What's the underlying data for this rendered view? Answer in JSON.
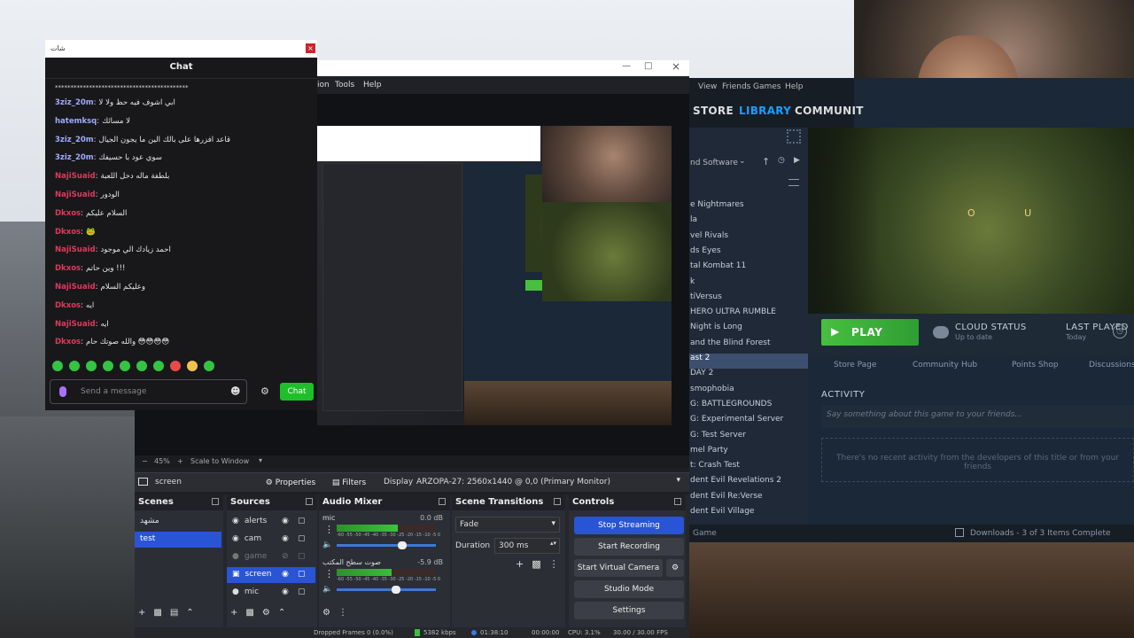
{
  "chat": {
    "window_title": "شات",
    "header": "Chat",
    "separator_line": "*******************************************",
    "messages": [
      {
        "user": "3ziz_20m",
        "user_color": "#9fa9ff",
        "text": "ابي اشوف فيه حظ ولا لا"
      },
      {
        "user": "hatemksq",
        "user_color": "#9fa9ff",
        "text": "لا مسائك"
      },
      {
        "user": "3ziz_20m",
        "user_color": "#9fa9ff",
        "text": "قاعد افزرها على بالك الين ما يجون الجيال"
      },
      {
        "user": "3ziz_20m",
        "user_color": "#9fa9ff",
        "text": "سوي عود با حسيفك"
      },
      {
        "user": "NajiSuaid",
        "user_color": "#e0395c",
        "text": "بلطفة ماله دخل اللعبة"
      },
      {
        "user": "NajiSuaid",
        "user_color": "#e0395c",
        "text": "الودور"
      },
      {
        "user": "Dkxos",
        "user_color": "#e0395c",
        "text": "السلام عليكم"
      },
      {
        "user": "Dkxos",
        "user_color": "#e0395c",
        "text": "🐸"
      },
      {
        "user": "NajiSuaid",
        "user_color": "#e0395c",
        "text": "احمد زيادك الي موجود"
      },
      {
        "user": "Dkxos",
        "user_color": "#e0395c",
        "text": "وين حاتم !!!"
      },
      {
        "user": "NajiSuaid",
        "user_color": "#e0395c",
        "text": "وعليكم السلام"
      },
      {
        "user": "Dkxos",
        "user_color": "#e0395c",
        "text": "ايه"
      },
      {
        "user": "NajiSuaid",
        "user_color": "#e0395c",
        "text": "ايه"
      },
      {
        "user": "Dkxos",
        "user_color": "#e0395c",
        "text": "والله صوتك حام 😳😳😳😳"
      }
    ],
    "input_placeholder": "Send a message",
    "send_label": "Chat"
  },
  "obs": {
    "menu": {
      "tools": "Tools",
      "help": "Help",
      "view_fragment": "ion"
    },
    "status_zoom": "45%",
    "scale_label": "Scale to Window",
    "context": {
      "source_name": "screen",
      "properties": "Properties",
      "filters": "Filters",
      "display_label": "Display",
      "display_value": "ARZOPA-27: 2560x1440 @ 0,0 (Primary Monitor)"
    },
    "scenes": {
      "title": "Scenes",
      "items": [
        "مشهد",
        "test"
      ],
      "selected": 1
    },
    "sources": {
      "title": "Sources",
      "items": [
        "alerts",
        "cam",
        "game",
        "screen",
        "mic"
      ],
      "selected": 3
    },
    "audio": {
      "title": "Audio Mixer",
      "channels": [
        {
          "name": "mic",
          "db": "0.0 dB",
          "level": 0.62
        },
        {
          "name": "صوت سطح المكتب",
          "db": "-5.9 dB",
          "level": 0.55
        }
      ],
      "ticks": "-60 -55 -50 -45 -40 -35 -30 -25 -20 -15 -10 -5 0"
    },
    "transitions": {
      "title": "Scene Transitions",
      "type": "Fade",
      "duration_label": "Duration",
      "duration_value": "300 ms"
    },
    "controls": {
      "title": "Controls",
      "stop_streaming": "Stop Streaming",
      "start_recording": "Start Recording",
      "start_virtual_camera": "Start Virtual Camera",
      "studio_mode": "Studio Mode",
      "settings": "Settings"
    },
    "statusbar": {
      "dropped": "Dropped Frames 0 (0.0%)",
      "kbps": "5382 kbps",
      "live": "01:38:10",
      "rec": "00:00:00",
      "cpu": "CPU: 3.1%",
      "fps": "30.00 / 30.00 FPS"
    }
  },
  "steam": {
    "menu": [
      "View",
      "Friends",
      "Games",
      "Help"
    ],
    "nav": [
      "STORE",
      "LIBRARY",
      "COMMUNIT"
    ],
    "filter_label": "nd Software",
    "games": [
      "e Nightmares",
      "la",
      "vel Rivals",
      "ds Eyes",
      "tal Kombat 11",
      "k",
      "tiVersus",
      "HERO ULTRA RUMBLE",
      "Night is Long",
      "and the Blind Forest",
      "ast 2",
      "DAY 2",
      "smophobia",
      "G: BATTLEGROUNDS",
      "G: Experimental Server",
      "G: Test Server",
      "mel Party",
      "t: Crash Test",
      "dent Evil Revelations 2",
      "dent Evil Re:Verse",
      "dent Evil Village"
    ],
    "selected_game": 10,
    "play_label": "PLAY",
    "cloud_status": "CLOUD STATUS",
    "cloud_sub": "Up to date",
    "last_played": "LAST PLAYED",
    "last_played_sub": "Today",
    "tabs": [
      "Store Page",
      "Community Hub",
      "Points Shop",
      "Discussions"
    ],
    "activity_title": "ACTIVITY",
    "activity_placeholder": "Say something about this game to your friends...",
    "no_recent": "There's no recent activity from the developers of this title or from your friends",
    "footer_left": "Game",
    "downloads": "Downloads - 3 of 3 Items Complete",
    "hero_letters": "O U"
  },
  "colors": {
    "steam_play": "#47bf3f",
    "twitch_green": "#1fbf2a",
    "obs_selected": "#2a54d6",
    "steam_selected": "#3d4f6e"
  }
}
